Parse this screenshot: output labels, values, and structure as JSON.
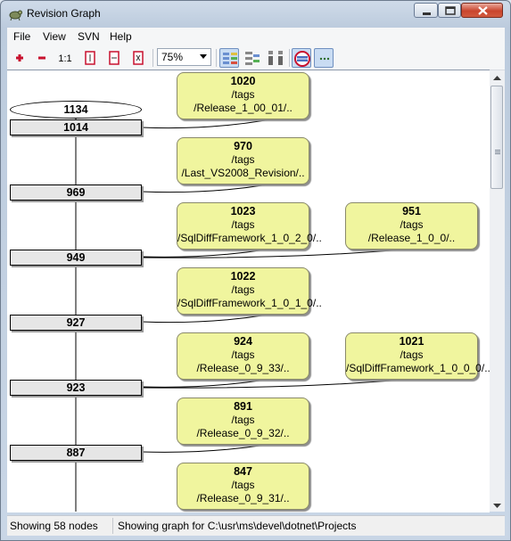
{
  "window": {
    "title": "Revision Graph"
  },
  "menu": {
    "items": [
      "File",
      "View",
      "SVN",
      "Help"
    ]
  },
  "toolbar": {
    "buttons": [
      {
        "name": "expand-all-icon"
      },
      {
        "name": "collapse-all-icon"
      },
      {
        "name": "zoom-original",
        "label": "1:1"
      },
      {
        "name": "fit-height-icon"
      },
      {
        "name": "fit-width-icon"
      },
      {
        "name": "fit-window-icon"
      },
      {
        "name": "group-branches-icon"
      },
      {
        "name": "top-down-layout-icon"
      },
      {
        "name": "arrange-columns-icon"
      },
      {
        "name": "show-head-icon"
      },
      {
        "name": "show-all-icon"
      }
    ],
    "zoom": "75%"
  },
  "graph": {
    "head": "1134",
    "revisions": [
      "1014",
      "969",
      "949",
      "927",
      "923",
      "887"
    ],
    "tags": [
      {
        "rev": "1020",
        "line": "/tags",
        "path": "/Release_1_00_01/.."
      },
      {
        "rev": "970",
        "line": "/tags",
        "path": "/Last_VS2008_Revision/.."
      },
      {
        "rev": "1023",
        "line": "/tags",
        "path": "/SqlDiffFramework_1_0_2_0/.."
      },
      {
        "rev": "951",
        "line": "/tags",
        "path": "/Release_1_0_0/.."
      },
      {
        "rev": "1022",
        "line": "/tags",
        "path": "/SqlDiffFramework_1_0_1_0/.."
      },
      {
        "rev": "924",
        "line": "/tags",
        "path": "/Release_0_9_33/.."
      },
      {
        "rev": "1021",
        "line": "/tags",
        "path": "/SqlDiffFramework_1_0_0_0/.."
      },
      {
        "rev": "891",
        "line": "/tags",
        "path": "/Release_0_9_32/.."
      },
      {
        "rev": "847",
        "line": "/tags",
        "path": "/Release_0_9_31/.."
      }
    ]
  },
  "status": {
    "nodes": "Showing 58 nodes",
    "path": "Showing graph for C:\\usr\\ms\\devel\\dotnet\\Projects"
  }
}
